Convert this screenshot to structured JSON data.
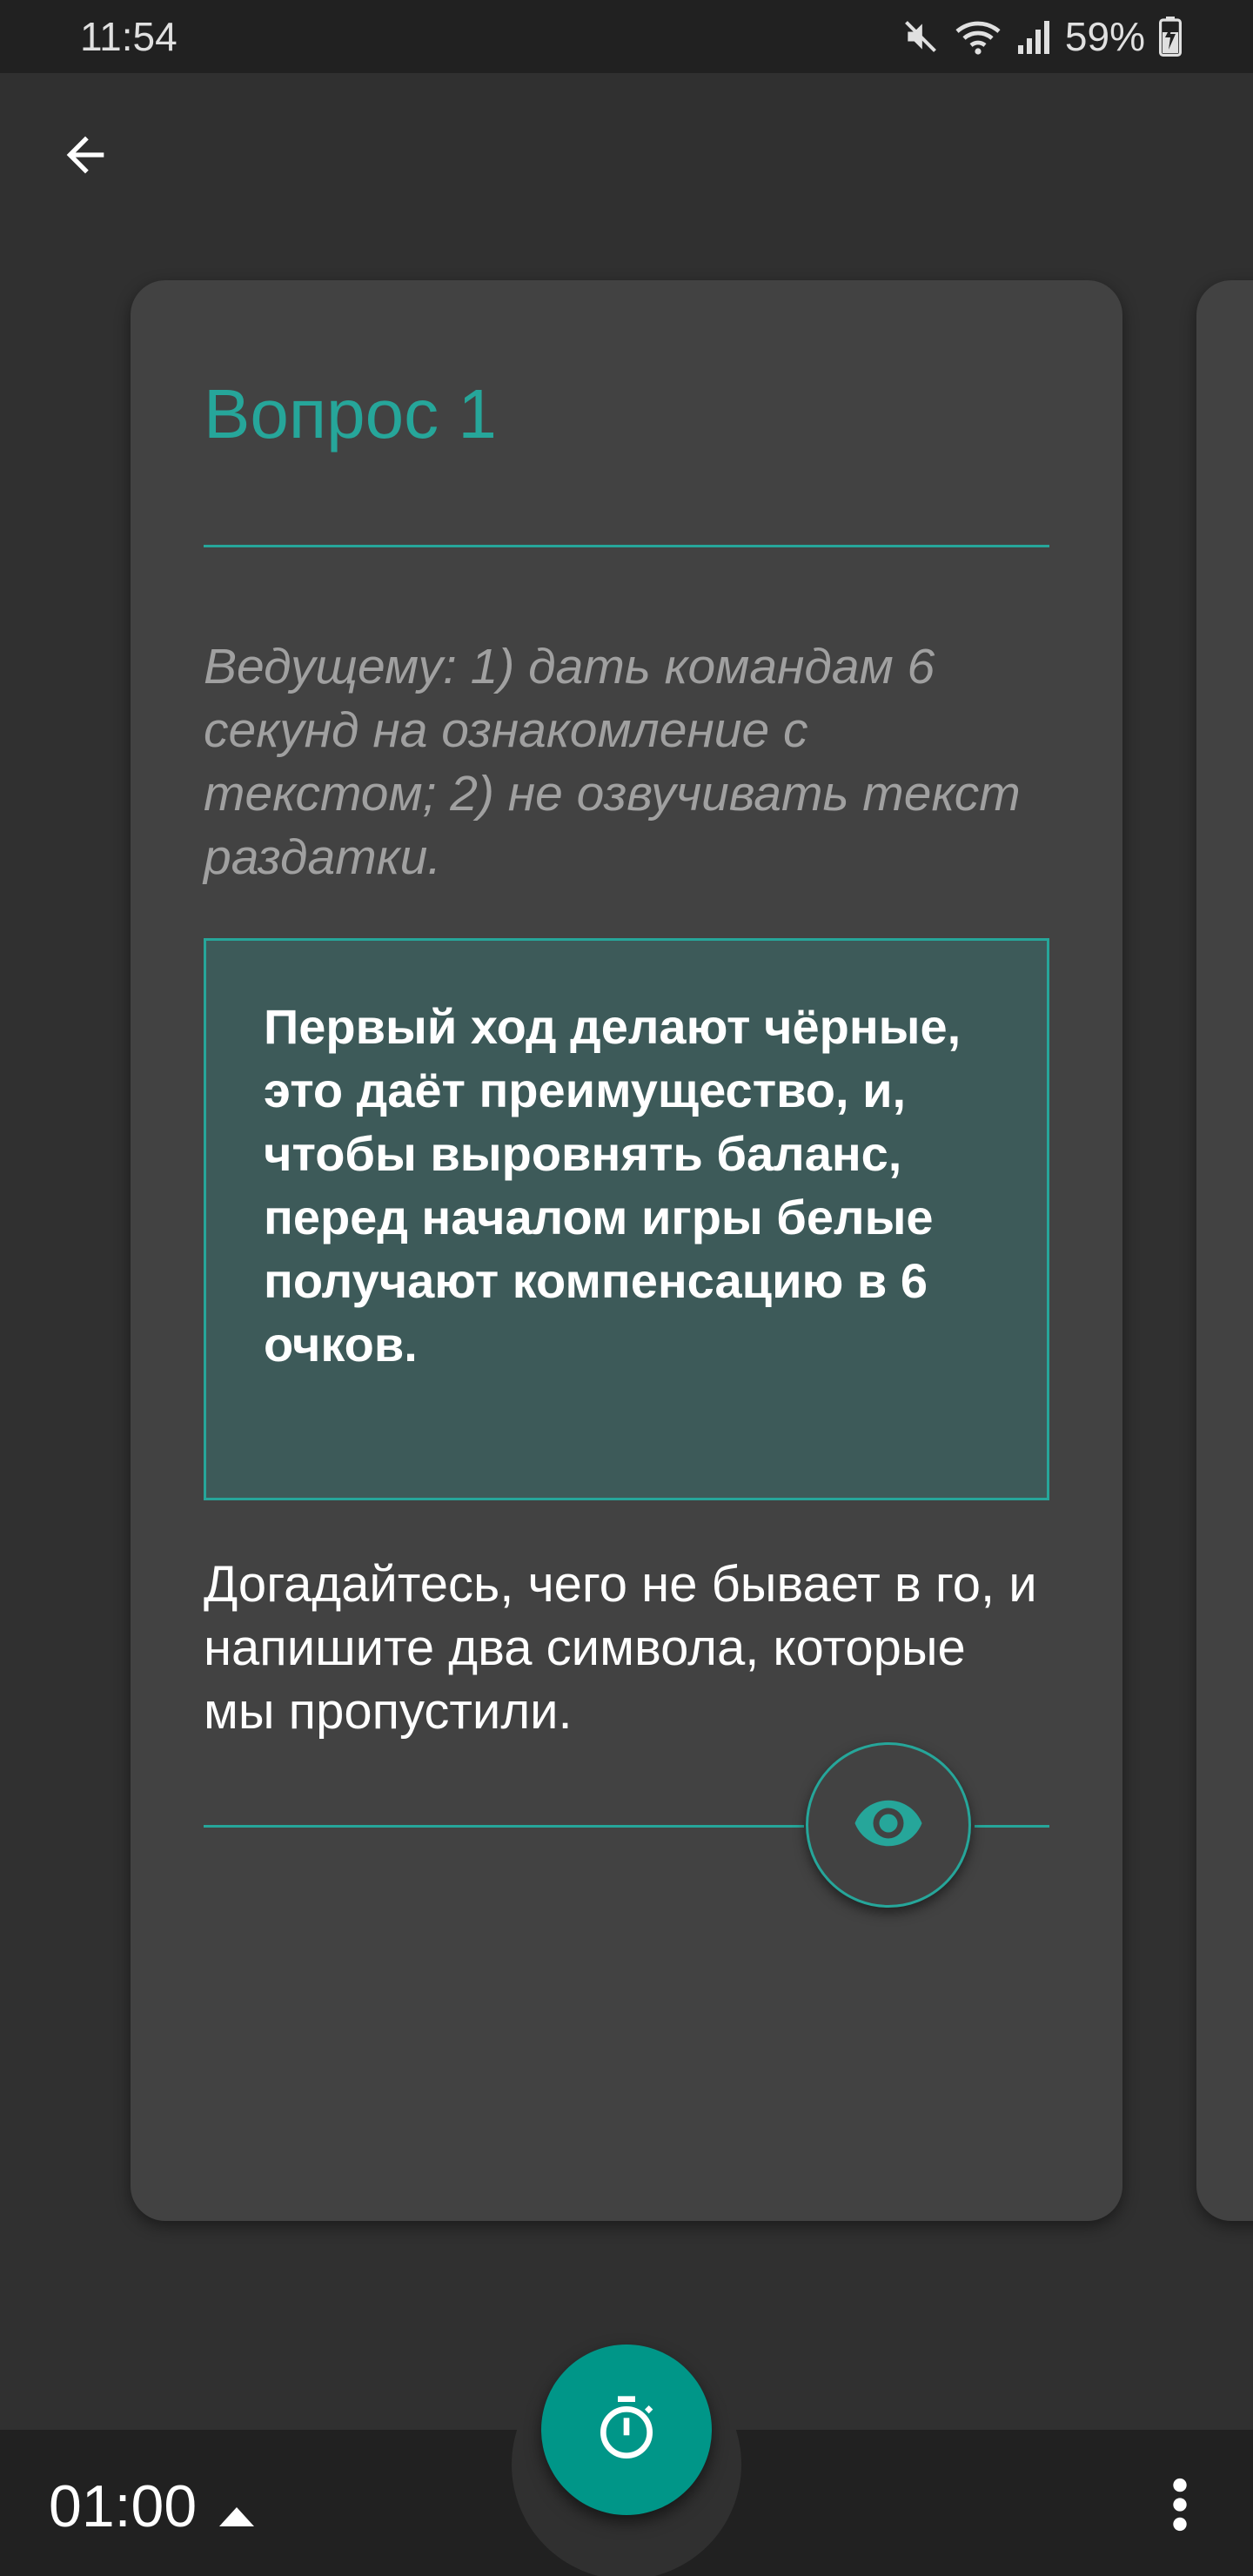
{
  "status_bar": {
    "time": "11:54",
    "battery": "59%",
    "icons": [
      "mute-icon",
      "wifi-icon",
      "signal-icon",
      "battery-charging-icon"
    ]
  },
  "app_bar": {
    "back_icon": "arrow-back-icon"
  },
  "card": {
    "title": "Вопрос 1",
    "host_note": "Ведущему: 1) дать командам 6 секунд на ознакомление с текстом; 2) не озвучивать текст раздатки.",
    "handout_text": "Первый ход делают чёрные, это даёт преимущество, и, чтобы выровнять баланс, перед началом игры белые получают компенсацию в 6 очков.",
    "question_text": "Догадайтесь, чего не бывает в го, и напишите два символа, которые мы пропустили.",
    "show_answer_icon": "eye-icon"
  },
  "bottom_bar": {
    "timer_value": "01:00",
    "timer_toggle_icon": "arrow-up-icon",
    "timer_fab_icon": "stopwatch-icon",
    "more_icon": "more-vert-icon"
  },
  "colors": {
    "accent": "#26a69a",
    "fab": "#009688",
    "card": "#424242",
    "background": "#303030",
    "handout_bg": "#3d5a59"
  }
}
